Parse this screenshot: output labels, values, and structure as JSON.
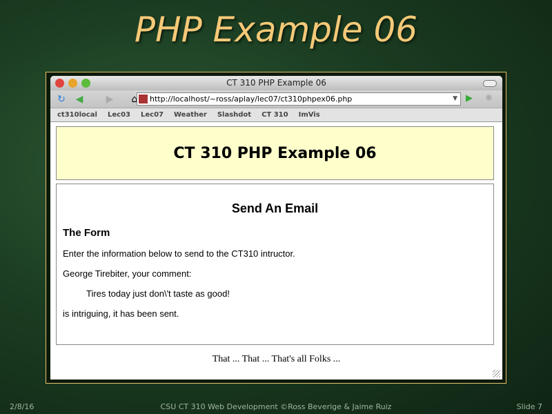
{
  "slide": {
    "title": "PHP Example 06",
    "date": "2/8/16",
    "footer": "CSU CT 310 Web Development ©Ross Beverige & Jaime Ruiz",
    "number": "Slide 7"
  },
  "browser": {
    "window_title": "CT 310 PHP Example 06",
    "url": "http://localhost/~ross/aplay/lec07/ct310phpex06.php",
    "bookmarks": [
      "ct310local",
      "Lec03",
      "Lec07",
      "Weather",
      "Slashdot",
      "CT 310",
      "ImVis"
    ]
  },
  "page": {
    "header": "CT 310 PHP Example 06",
    "heading": "Send An Email",
    "subheading": "The Form",
    "intro": "Enter the information below to send to the CT310 intructor.",
    "comment_label": "George Tirebiter, your comment:",
    "comment": "Tires today just don\\'t taste as good!",
    "result": "is intriguing, it has been sent.",
    "footer": "That ... That ... That's all Folks ..."
  }
}
